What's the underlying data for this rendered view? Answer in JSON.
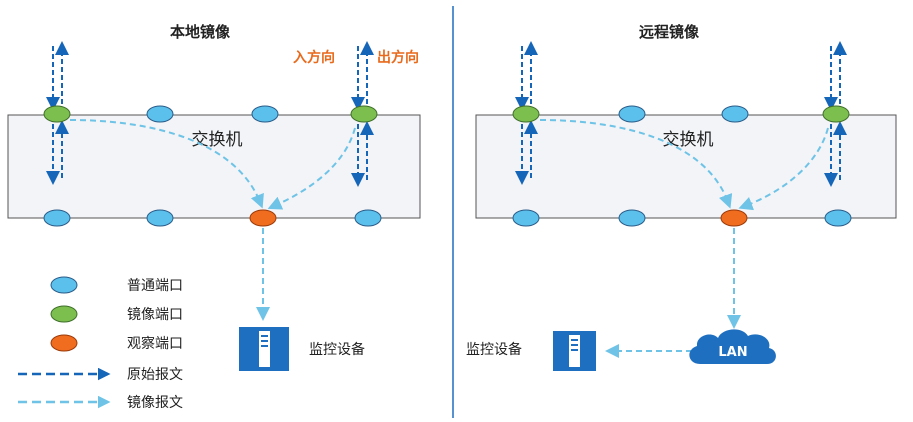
{
  "local": {
    "title": "本地镜像",
    "switch_label": "交换机",
    "in_direction": "入方向",
    "out_direction": "出方向",
    "monitor_label": "监控设备"
  },
  "remote": {
    "title": "远程镜像",
    "switch_label": "交换机",
    "lan_label": "LAN",
    "monitor_label": "监控设备"
  },
  "legend": {
    "normal_port": "普通端口",
    "mirror_port": "镜像端口",
    "observe_port": "观察端口",
    "original_packet": "原始报文",
    "mirror_packet": "镜像报文"
  },
  "colors": {
    "normal_port": "#5bc0eb",
    "mirror_port": "#7dbf4e",
    "observe_port": "#f06c1e",
    "original_arrow": "#1565b8",
    "mirror_arrow": "#6ec3e6",
    "direction_text": "#e86a1c",
    "device": "#1f6fc0",
    "divider": "#1f6fc0"
  }
}
